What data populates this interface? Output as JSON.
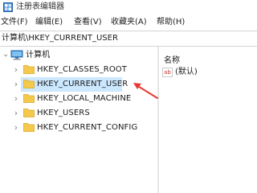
{
  "window": {
    "title": "注册表编辑器",
    "icon": "registry-editor-icon"
  },
  "menu": {
    "items": [
      "文件(F)",
      "编辑(E)",
      "查看(V)",
      "收藏夹(A)",
      "帮助(H)"
    ]
  },
  "address": {
    "path": "计算机\\HKEY_CURRENT_USER"
  },
  "tree": {
    "root_label": "计算机",
    "root_icon": "computer-icon",
    "children": [
      {
        "label": "HKEY_CLASSES_ROOT",
        "selected": false
      },
      {
        "label": "HKEY_CURRENT_USER",
        "selected": true
      },
      {
        "label": "HKEY_LOCAL_MACHINE",
        "selected": false
      },
      {
        "label": "HKEY_USERS",
        "selected": false
      },
      {
        "label": "HKEY_CURRENT_CONFIG",
        "selected": false
      }
    ]
  },
  "list": {
    "column_name": "名称",
    "values": [
      {
        "name": "(默认)",
        "icon": "ab-string-icon"
      }
    ]
  },
  "colors": {
    "selection": "#cce8ff",
    "folder": "#f5c94c",
    "annotation_arrow": "#e53935"
  }
}
